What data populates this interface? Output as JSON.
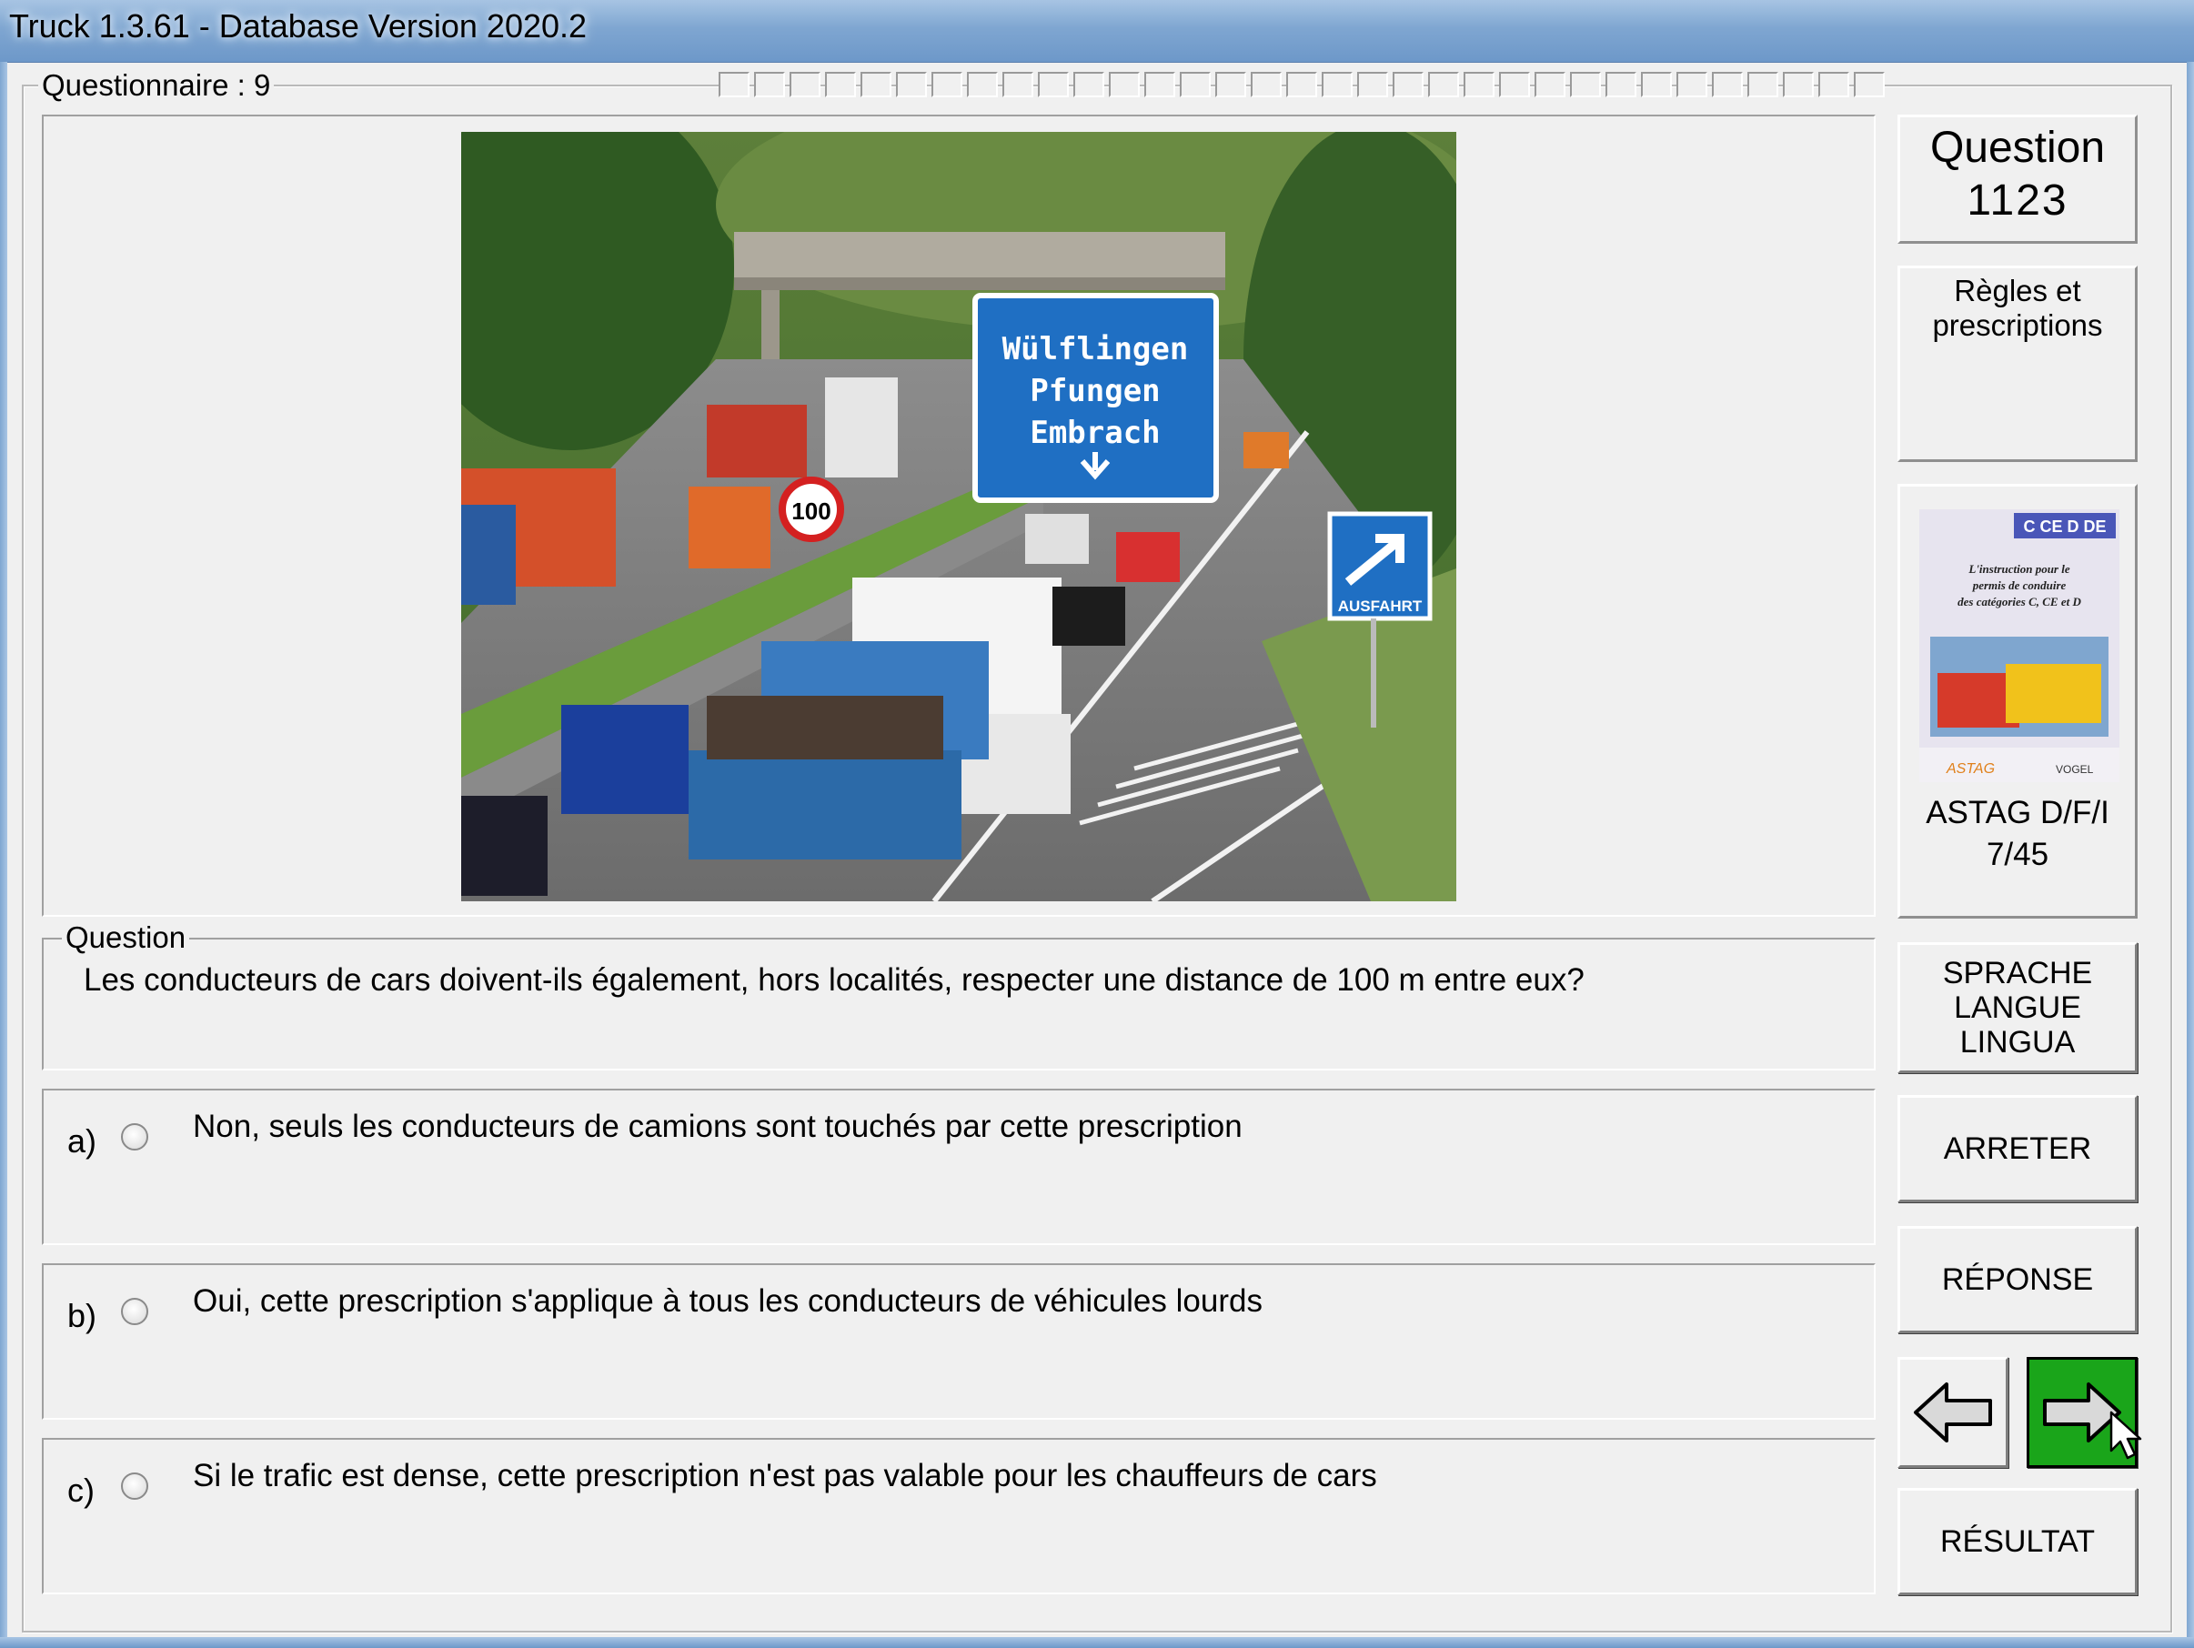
{
  "window": {
    "title": "Truck 1.3.61 - Database Version 2020.2"
  },
  "questionnaire": {
    "legend": "Questionnaire : 9",
    "progress_total": 33,
    "progress_done_index": 34
  },
  "photo": {
    "signs": {
      "direction_lines": [
        "Wülflingen",
        "Pfungen",
        "Embrach"
      ],
      "exit": "AUSFAHRT",
      "speed": "100"
    }
  },
  "question": {
    "legend": "Question",
    "text": "Les conducteurs de cars doivent-ils également, hors localités, respecter une distance de 100 m entre eux?"
  },
  "answers": [
    {
      "label": "a)",
      "text": "Non, seuls les conducteurs de camions sont touchés par cette prescription"
    },
    {
      "label": "b)",
      "text": "Oui, cette prescription s'applique à tous les conducteurs de véhicules lourds"
    },
    {
      "label": "c)",
      "text": "Si le trafic est dense, cette prescription n'est pas valable pour les chauffeurs de cars"
    }
  ],
  "sidebar": {
    "question_label": "Question",
    "question_number": "1123",
    "category_line1": "Règles et",
    "category_line2": "prescriptions",
    "book": {
      "badge": "C CE D DE",
      "caption_lines": [
        "L'instruction pour le",
        "permis de conduire",
        "des catégories C, CE et D"
      ],
      "source_line1": "ASTAG D/F/I",
      "source_line2": "7/45"
    },
    "language_lines": [
      "SPRACHE",
      "LANGUE",
      "LINGUA"
    ],
    "stop_label": "ARRETER",
    "answer_label": "RÉPONSE",
    "result_label": "RÉSULTAT"
  },
  "colors": {
    "next_button": "#1aa51a",
    "sign_blue": "#1f6fc3",
    "progress_done": "#ffffc8"
  }
}
